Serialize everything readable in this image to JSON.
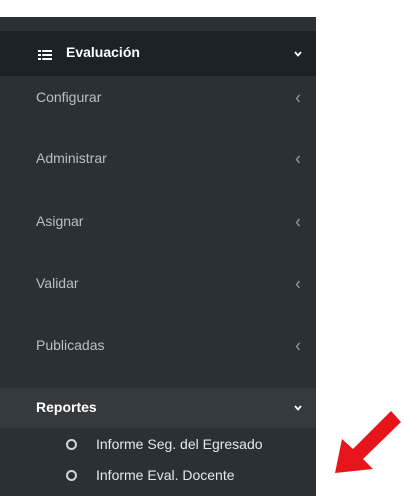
{
  "sidebar": {
    "section": {
      "label": "Evaluación",
      "icon": "list-icon"
    },
    "items": [
      {
        "label": "Configurar"
      },
      {
        "label": "Administrar"
      },
      {
        "label": "Asignar"
      },
      {
        "label": "Validar"
      },
      {
        "label": "Publicadas"
      }
    ],
    "reports": {
      "label": "Reportes",
      "subitems": [
        {
          "label": "Informe Seg. del Egresado"
        },
        {
          "label": "Informe Eval. Docente"
        }
      ]
    }
  },
  "colors": {
    "sidebar_bg": "#2b3034",
    "header_bg": "#1d2226",
    "active_bg": "#353a3f",
    "annotation_arrow": "#e8141b"
  }
}
